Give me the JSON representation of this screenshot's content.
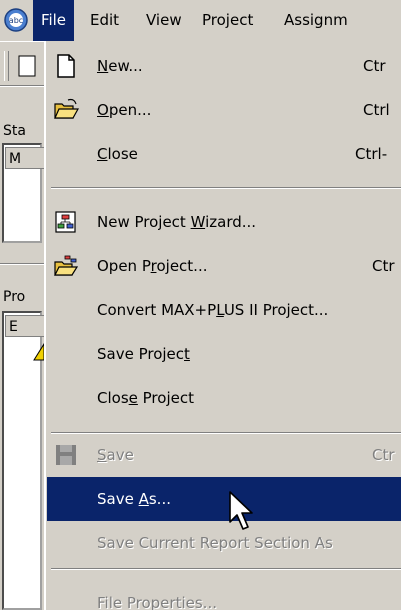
{
  "menubar": {
    "items": [
      {
        "label": "File",
        "active": true
      },
      {
        "label": "Edit"
      },
      {
        "label": "View"
      },
      {
        "label": "Project"
      },
      {
        "label": "Assignm"
      }
    ]
  },
  "background": {
    "status_label": "Sta",
    "status_header": "M",
    "project_label": "Pro",
    "project_header": "E"
  },
  "file_menu": {
    "items": [
      {
        "pre": "",
        "mnemonic": "N",
        "post": "ew...",
        "shortcut": "Ctr",
        "icon": "new-document-icon"
      },
      {
        "pre": "",
        "mnemonic": "O",
        "post": "pen...",
        "shortcut": "Ctrl",
        "icon": "open-folder-icon"
      },
      {
        "pre": "",
        "mnemonic": "C",
        "post": "lose",
        "shortcut": "Ctrl-"
      },
      {
        "pre": "New Project ",
        "mnemonic": "W",
        "post": "izard...",
        "icon": "project-wizard-icon"
      },
      {
        "pre": "Open P",
        "mnemonic": "r",
        "post": "oject...",
        "shortcut": "Ctr",
        "icon": "open-project-icon"
      },
      {
        "pre": "Convert MAX+P",
        "mnemonic": "L",
        "post": "US II Project..."
      },
      {
        "pre": "Save Projec",
        "mnemonic": "t",
        "post": ""
      },
      {
        "pre": "Clos",
        "mnemonic": "e",
        "post": " Project"
      },
      {
        "pre": "",
        "mnemonic": "S",
        "post": "ave",
        "shortcut": "Ctr",
        "disabled": true,
        "icon": "save-disk-icon"
      },
      {
        "pre": "Save ",
        "mnemonic": "A",
        "post": "s...",
        "selected": true
      },
      {
        "pre": "Save Current Report Section As",
        "mnemonic": "",
        "post": "",
        "disabled": true
      },
      {
        "pre": "File Properties...",
        "mnemonic": "",
        "post": "",
        "disabled": true
      }
    ]
  },
  "colors": {
    "menu_bg": "#d4d0c8",
    "highlight": "#0a246a",
    "disabled_text": "#808080"
  }
}
